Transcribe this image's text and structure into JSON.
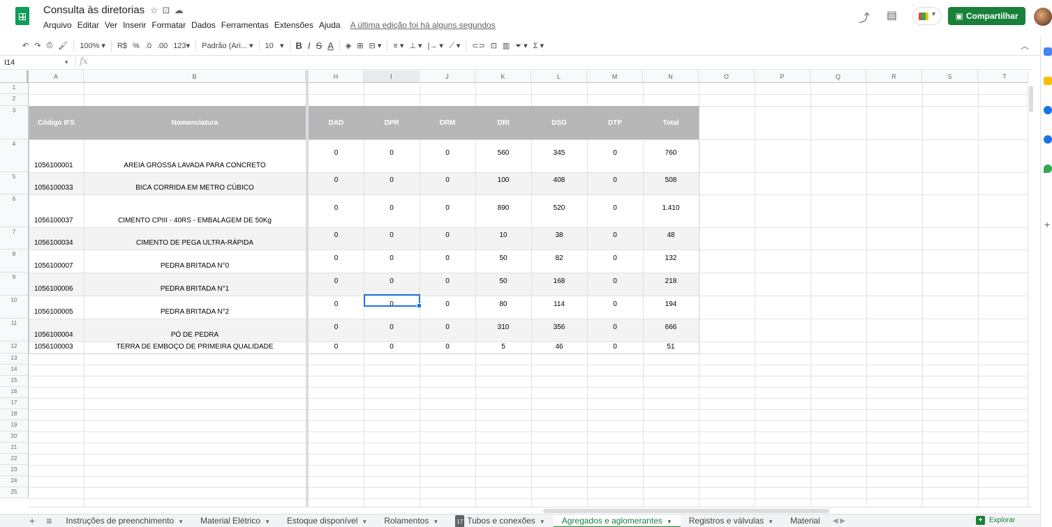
{
  "window": {
    "title": "Consulta às diretorias",
    "menu": [
      "Arquivo",
      "Editar",
      "Ver",
      "Inserir",
      "Formatar",
      "Dados",
      "Ferramentas",
      "Extensões",
      "Ajuda"
    ],
    "last_edit": "A última edição foi há alguns segundos",
    "share_label": "Compartilhar"
  },
  "toolbar": {
    "zoom": "100%",
    "currency": "R$",
    "percent": "%",
    "dec_less": ".0",
    "dec_more": ".00",
    "format_more": "123",
    "font": "Padrão (Ari...",
    "font_size": "10",
    "bold": "B",
    "italic": "I",
    "strike": "S",
    "text_color": "A",
    "sum": "Σ"
  },
  "formula_bar": {
    "cell_ref": "I14",
    "fx": "fx",
    "content": ""
  },
  "columns": [
    "A",
    "B",
    "H",
    "I",
    "J",
    "K",
    "L",
    "M",
    "N",
    "O",
    "P",
    "Q",
    "R",
    "S",
    "T"
  ],
  "selected_column": "I",
  "row_numbers": [
    "1",
    "2",
    "3",
    "4",
    "5",
    "6",
    "7",
    "8",
    "9",
    "10",
    "11",
    "12",
    "13",
    "14",
    "15",
    "16",
    "17",
    "18",
    "19",
    "20",
    "21",
    "22",
    "23",
    "24",
    "25"
  ],
  "table": {
    "headers": [
      "Código IFS",
      "Nomenclatura",
      "DAD",
      "DPR",
      "DRM",
      "DRI",
      "DSG",
      "DTP",
      "Total"
    ],
    "rows": [
      [
        "1056100001",
        "AREIA GROSSA LAVADA PARA CONCRETO",
        "0",
        "0",
        "0",
        "560",
        "345",
        "0",
        "760"
      ],
      [
        "1056100033",
        "BICA CORRIDA EM METRO CÚBICO",
        "0",
        "0",
        "0",
        "100",
        "408",
        "0",
        "508"
      ],
      [
        "1056100037",
        "CIMENTO CPIII - 40RS - EMBALAGEM DE 50Kg",
        "0",
        "0",
        "0",
        "890",
        "520",
        "0",
        "1.410"
      ],
      [
        "1056100034",
        "CIMENTO DE PEGA ULTRA-RÁPIDA",
        "0",
        "0",
        "0",
        "10",
        "38",
        "0",
        "48"
      ],
      [
        "1056100007",
        "PEDRA BRITADA N°0",
        "0",
        "0",
        "0",
        "50",
        "82",
        "0",
        "132"
      ],
      [
        "1056100006",
        "PEDRA BRITADA N°1",
        "0",
        "0",
        "0",
        "50",
        "168",
        "0",
        "218"
      ],
      [
        "1056100005",
        "PEDRA BRITADA N°2",
        "0",
        "0",
        "0",
        "80",
        "114",
        "0",
        "194"
      ],
      [
        "1056100004",
        "PÓ DE PEDRA",
        "0",
        "0",
        "0",
        "310",
        "356",
        "0",
        "666"
      ],
      [
        "1056100003",
        "TERRA DE EMBOÇO DE PRIMEIRA QUALIDADE",
        "0",
        "0",
        "0",
        "5",
        "46",
        "0",
        "51"
      ]
    ]
  },
  "sheet_tabs": [
    {
      "label": "Instruções de preenchimento",
      "active": false
    },
    {
      "label": "Material Elétrico",
      "active": false
    },
    {
      "label": "Estoque disponível",
      "active": false
    },
    {
      "label": "Rolamentos",
      "active": false
    },
    {
      "label": "Tubos e conexões",
      "active": false,
      "badge": "17"
    },
    {
      "label": "Agregados e aglomerantes",
      "active": true
    },
    {
      "label": "Registros e válvulas",
      "active": false
    },
    {
      "label": "Material",
      "active": false
    }
  ],
  "explore_label": "Explorar",
  "colors": {
    "brand_green": "#188038",
    "header_gray": "#b7b7b7",
    "stripe": "#f3f3f3",
    "selection_blue": "#1a73e8"
  }
}
